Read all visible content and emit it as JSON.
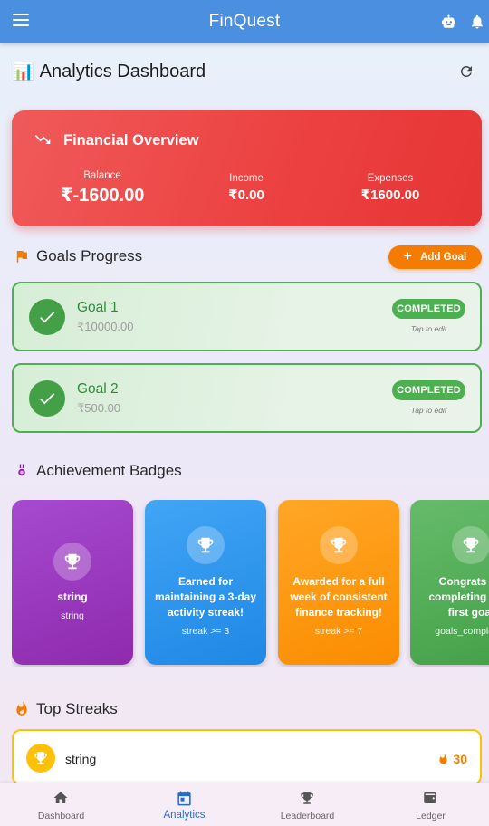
{
  "app": {
    "title": "FinQuest",
    "icons": [
      "menu-icon",
      "robot-icon",
      "bell-icon"
    ]
  },
  "page": {
    "emoji": "📊",
    "title": "Analytics Dashboard",
    "refresh_icon": "refresh-icon"
  },
  "overview": {
    "title": "Financial Overview",
    "icon": "trending-down-icon",
    "balance_label": "Balance",
    "balance_value": "₹-1600.00",
    "income_label": "Income",
    "income_value": "₹0.00",
    "expenses_label": "Expenses",
    "expenses_value": "₹1600.00",
    "color": "#ec4040"
  },
  "goals": {
    "title": "Goals Progress",
    "add_label": "Add Goal",
    "items": [
      {
        "name": "Goal 1",
        "amount": "₹10000.00",
        "status": "COMPLETED",
        "hint": "Tap to edit"
      },
      {
        "name": "Goal 2",
        "amount": "₹500.00",
        "status": "COMPLETED",
        "hint": "Tap to edit"
      }
    ]
  },
  "badges": {
    "title": "Achievement Badges",
    "items": [
      {
        "title": "string",
        "sub": "string",
        "color": "#9c27b0"
      },
      {
        "title": "Earned for maintaining a 3-day activity streak!",
        "sub": "streak >= 3",
        "color": "#1e88e5"
      },
      {
        "title": "Awarded for a full week of consistent finance tracking!",
        "sub": "streak >= 7",
        "color": "#fb8c00"
      },
      {
        "title": "Congrats on completing your first goal",
        "sub": "goals_completed",
        "color": "#43a047"
      }
    ]
  },
  "streaks": {
    "title": "Top Streaks",
    "items": [
      {
        "name": "string",
        "count": "30"
      }
    ]
  },
  "nav": {
    "items": [
      {
        "label": "Dashboard",
        "icon": "home-icon"
      },
      {
        "label": "Analytics",
        "icon": "calendar-icon",
        "active": true
      },
      {
        "label": "Leaderboard",
        "icon": "trophy-icon"
      },
      {
        "label": "Ledger",
        "icon": "wallet-icon"
      }
    ]
  }
}
